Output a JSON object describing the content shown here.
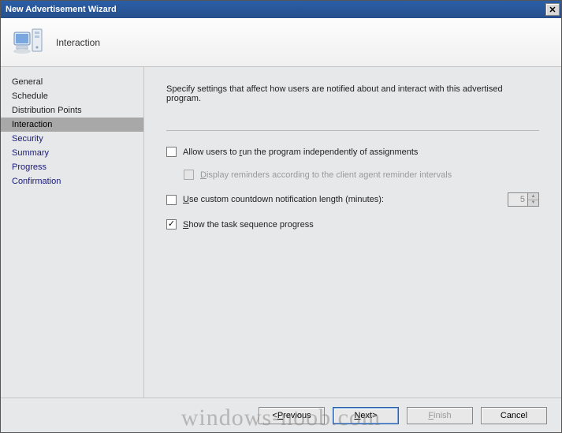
{
  "window": {
    "title": "New Advertisement Wizard"
  },
  "header": {
    "page_title": "Interaction"
  },
  "sidebar": {
    "items": [
      {
        "label": "General"
      },
      {
        "label": "Schedule"
      },
      {
        "label": "Distribution Points"
      },
      {
        "label": "Interaction"
      },
      {
        "label": "Security"
      },
      {
        "label": "Summary"
      },
      {
        "label": "Progress"
      },
      {
        "label": "Confirmation"
      }
    ]
  },
  "content": {
    "instruction": "Specify settings that affect how users are notified about and interact with this advertised program.",
    "allow_run": {
      "prefix": "Allow users to ",
      "hotkey": "r",
      "suffix": "un the program independently of assignments"
    },
    "reminders": {
      "hotkey": "D",
      "suffix": "isplay reminders according to the client agent reminder intervals"
    },
    "countdown": {
      "hotkey": "U",
      "suffix": "se custom countdown notification length (minutes):",
      "value": "5"
    },
    "show_progress": {
      "hotkey": "S",
      "suffix": "how the task sequence progress"
    }
  },
  "footer": {
    "previous": {
      "lt": "< ",
      "hotkey": "P",
      "rest": "revious"
    },
    "next": {
      "hotkey": "N",
      "rest": "ext ",
      "gt": ">"
    },
    "finish": {
      "hotkey": "F",
      "rest": "inish"
    },
    "cancel": {
      "label": "Cancel"
    }
  },
  "watermark": "windows-noob.com"
}
